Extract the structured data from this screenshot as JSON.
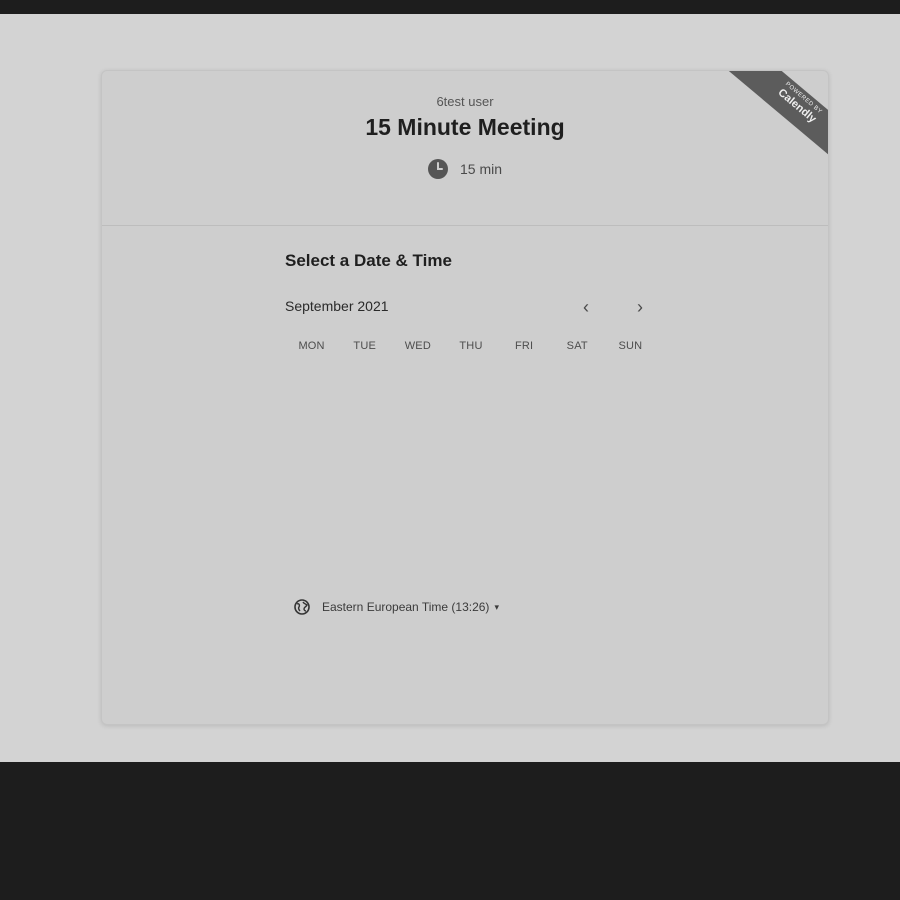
{
  "header": {
    "host_name": "6test user",
    "event_title": "15 Minute Meeting",
    "duration": "15 min"
  },
  "ribbon": {
    "small_text": "POWERED BY",
    "brand": "Calendly"
  },
  "calendar": {
    "section_title": "Select a Date & Time",
    "month_label": "September 2021",
    "prev_label": "‹",
    "next_label": "›",
    "weekdays": [
      "MON",
      "TUE",
      "WED",
      "THU",
      "FRI",
      "SAT",
      "SUN"
    ]
  },
  "timezone": {
    "label": "Eastern European Time (13:26)",
    "caret": "▾"
  },
  "icons": {
    "clock": "clock-icon",
    "globe": "globe-icon",
    "previous": "chevron-left-icon",
    "next": "chevron-right-icon",
    "dropdown": "caret-down-icon"
  }
}
